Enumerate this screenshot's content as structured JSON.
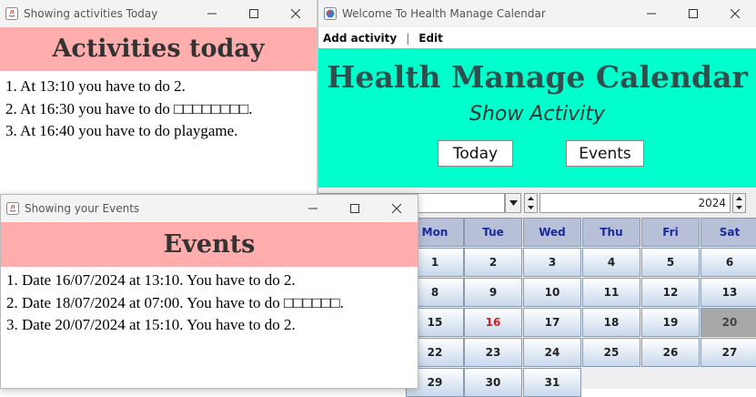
{
  "activities_window": {
    "title": "Showing activities Today",
    "heading": "Activities today",
    "items": [
      "1. At 13:10 you have to do 2.",
      "2. At 16:30 you have to do □□□□□□□□.",
      "3. At 16:40 you have to do playgame."
    ]
  },
  "events_window": {
    "title": "Showing your Events",
    "heading": "Events",
    "items": [
      "1. Date 16/07/2024 at 13:10. You have to do 2.",
      "2. Date 18/07/2024 at 07:00. You have to do □□□□□□.",
      "3. Date 20/07/2024 at 15:10. You have to do 2."
    ]
  },
  "main_window": {
    "title": "Welcome To Health Manage Calendar",
    "menu": {
      "add_activity": "Add activity",
      "separator": "|",
      "edit": "Edit"
    },
    "heading": "Health Manage Calendar",
    "subheading": "Show Activity",
    "today_button": "Today",
    "events_button": "Events",
    "calendar": {
      "year": "2024",
      "day_headers": [
        "Mon",
        "Tue",
        "Wed",
        "Thu",
        "Fri",
        "Sat"
      ],
      "weeks": [
        [
          "1",
          "2",
          "3",
          "4",
          "5",
          "6"
        ],
        [
          "8",
          "9",
          "10",
          "11",
          "12",
          "13"
        ],
        [
          "15",
          "16",
          "17",
          "18",
          "19",
          "20"
        ],
        [
          "22",
          "23",
          "24",
          "25",
          "26",
          "27"
        ],
        [
          "29",
          "30",
          "31",
          "",
          "",
          ""
        ]
      ],
      "today": "16",
      "selected": "20"
    }
  },
  "colors": {
    "banner_pink": "#ffadad",
    "hero_aqua": "#00ffcc",
    "hero_title": "#2f4f4f",
    "calendar_header_text": "#1a2a9a",
    "today_text": "#cc2222",
    "selected_cell": "#a8a8a8"
  }
}
